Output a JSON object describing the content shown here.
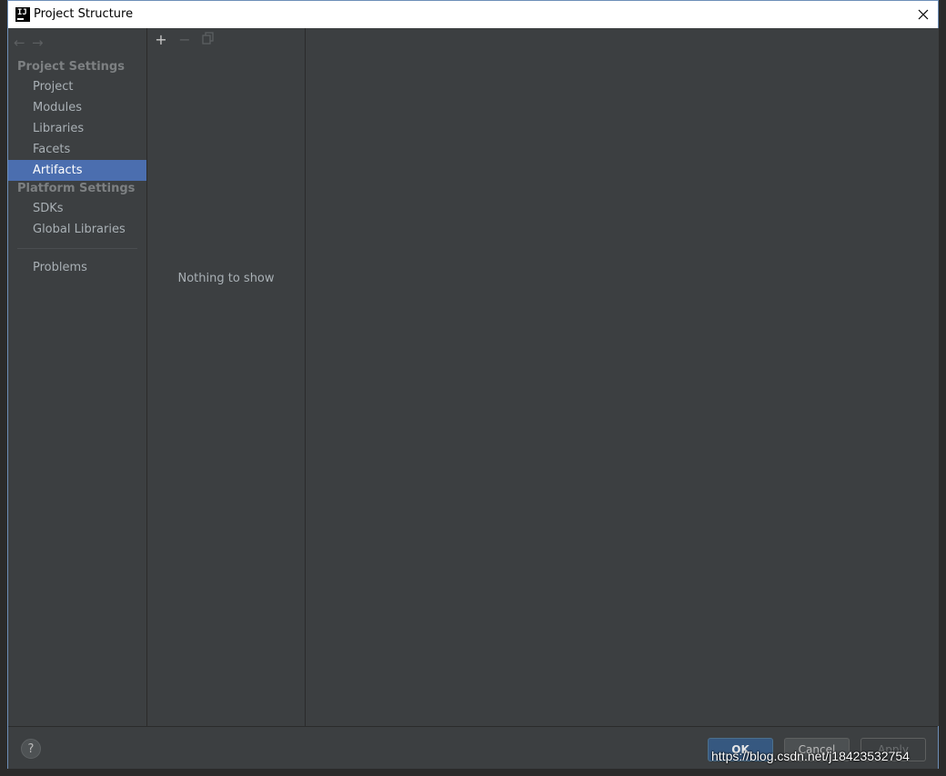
{
  "window": {
    "title": "Project Structure",
    "app_icon_text": "IJ"
  },
  "sidebar": {
    "project_settings_header": "Project Settings",
    "project_items": [
      {
        "label": "Project"
      },
      {
        "label": "Modules"
      },
      {
        "label": "Libraries"
      },
      {
        "label": "Facets"
      },
      {
        "label": "Artifacts",
        "selected": true
      }
    ],
    "platform_settings_header": "Platform Settings",
    "platform_items": [
      {
        "label": "SDKs"
      },
      {
        "label": "Global Libraries"
      }
    ],
    "problems_label": "Problems"
  },
  "middle": {
    "empty_text": "Nothing to show"
  },
  "footer": {
    "help_label": "?",
    "ok_label": "OK",
    "cancel_label": "Cancel",
    "apply_label": "Apply"
  },
  "watermark": "https://blog.csdn.net/j18423532754",
  "colors": {
    "selection": "#4b6eaf",
    "panel_bg": "#3c3f41",
    "ok_button": "#365880"
  }
}
